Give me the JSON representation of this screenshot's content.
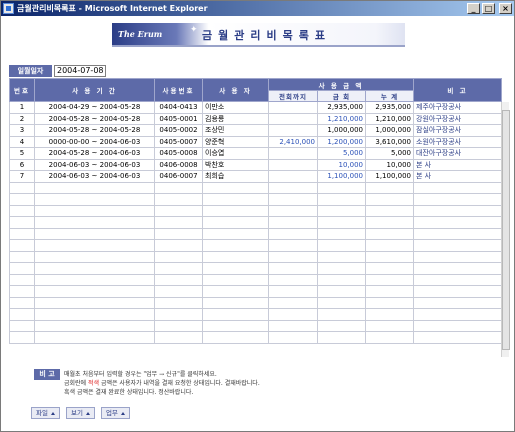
{
  "window": {
    "title": "금월관리비목록표 - Microsoft Internet Explorer",
    "min_label": "_",
    "max_label": "□",
    "close_label": "×"
  },
  "banner": {
    "brand": "The Erum",
    "title": "금월관리비목록표"
  },
  "date": {
    "label": "일월일자",
    "value": "2004-07-08"
  },
  "table": {
    "headers": {
      "no": "번호",
      "period": "사 용 기 간",
      "code": "사용번호",
      "user": "사 용 자",
      "amount_group": "사 용 금 액",
      "prev": "전회까지",
      "this": "금 회",
      "total": "누 계",
      "note": "비 고"
    },
    "rows": [
      {
        "no": "1",
        "period": "2004-04-29 ~ 2004-05-28",
        "code": "0404-0413",
        "user": "이만소",
        "prev": "",
        "this": "2,935,000",
        "total": "2,935,000",
        "note": "제주아구장공사"
      },
      {
        "no": "2",
        "period": "2004-05-28 ~ 2004-05-28",
        "code": "0405-0001",
        "user": "김용룡",
        "prev": "",
        "this": "1,210,000",
        "total": "1,210,000",
        "note": "강원아구장공사"
      },
      {
        "no": "3",
        "period": "2004-05-28 ~ 2004-05-28",
        "code": "0405-0002",
        "user": "조상민",
        "prev": "",
        "this": "1,000,000",
        "total": "1,000,000",
        "note": "잠실아구장공사"
      },
      {
        "no": "4",
        "period": "0000-00-00 ~ 2004-06-03",
        "code": "0405-0007",
        "user": "양준혁",
        "prev": "2,410,000",
        "this": "1,200,000",
        "total": "3,610,000",
        "note": "소원아구장공사"
      },
      {
        "no": "5",
        "period": "2004-05-28 ~ 2004-06-03",
        "code": "0405-0008",
        "user": "이승엽",
        "prev": "",
        "this": "5,000",
        "total": "5,000",
        "note": "대잔아구장공사"
      },
      {
        "no": "6",
        "period": "2004-06-03 ~ 2004-06-03",
        "code": "0406-0008",
        "user": "박찬호",
        "prev": "",
        "this": "10,000",
        "total": "10,000",
        "note": "본 사"
      },
      {
        "no": "7",
        "period": "2004-06-03 ~ 2004-06-03",
        "code": "0406-0007",
        "user": "최희습",
        "prev": "",
        "this": "1,100,000",
        "total": "1,100,000",
        "note": "본 사"
      }
    ],
    "this_blue_rows": [
      2,
      4,
      5,
      6,
      7
    ]
  },
  "notes": {
    "badge": "비 고",
    "line1": "매월초 처음부터 입력할 경우는 \"업무 → 신규\"를 클릭하세요.",
    "line2_a": "금회란에 ",
    "line2_red": "적색",
    "line2_b": " 금액은 사용자가 내역을 결재 요청한 상태입니다. 결재바랍니다.",
    "line3": "흑색 금액은 결재 완료한 상태입니다. 정산바랍니다."
  },
  "actions": {
    "file": "파일",
    "view": "보기",
    "work": "업무"
  },
  "colors": {
    "header": "#5d6aa8",
    "accent_blue": "#2b51b8",
    "red": "#dd2222"
  }
}
